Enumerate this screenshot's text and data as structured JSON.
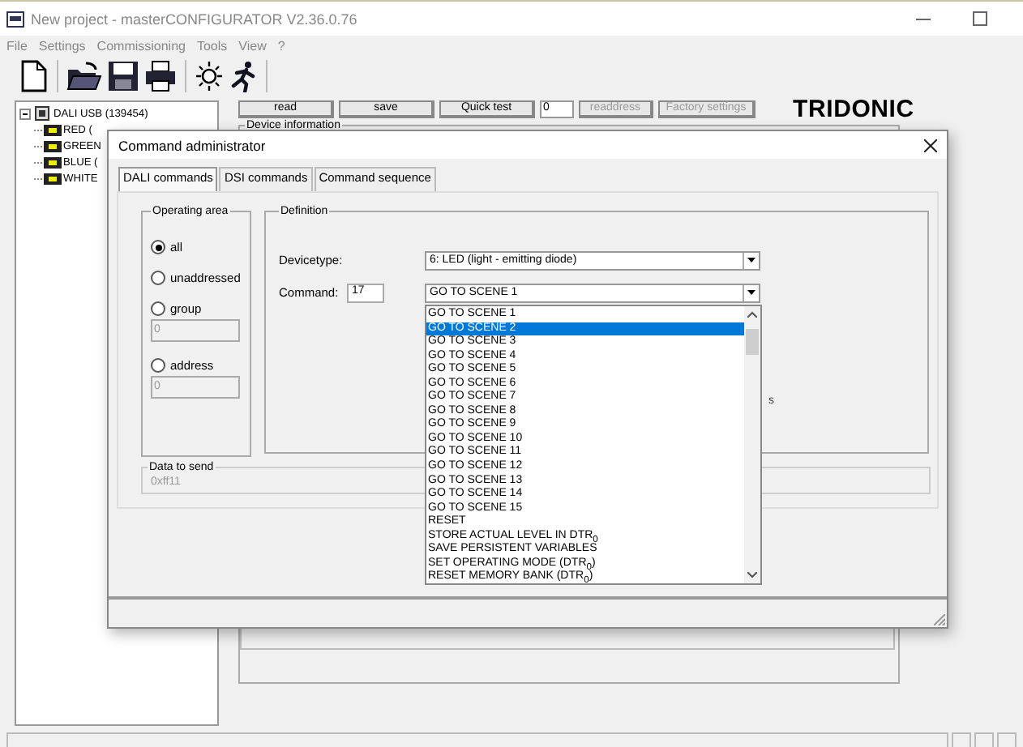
{
  "window": {
    "title": "New project - masterCONFIGURATOR V2.36.0.76"
  },
  "menu": [
    "File",
    "Settings",
    "Commissioning",
    "Tools",
    "View",
    "?"
  ],
  "tree": {
    "label": "DALI USB (139454)",
    "expanded": true,
    "children": [
      {
        "label": "RED ("
      },
      {
        "label": "GREEN"
      },
      {
        "label": "BLUE ("
      },
      {
        "label": "WHITE"
      }
    ]
  },
  "controls": [
    {
      "kind": "button",
      "label": "read",
      "disabled": false
    },
    {
      "kind": "button",
      "label": "save",
      "disabled": false
    },
    {
      "kind": "button",
      "label": "Quick test",
      "disabled": false
    },
    {
      "kind": "field",
      "value": "0"
    },
    {
      "kind": "button",
      "label": "readdress",
      "disabled": true
    },
    {
      "kind": "button",
      "label": "Factory settings",
      "disabled": true
    }
  ],
  "logo": "TRIDONIC",
  "device_info": {
    "title": "Device information"
  },
  "dialog": {
    "title": "Command administrator",
    "tabs": [
      {
        "label": "DALI commands",
        "selected": true
      },
      {
        "label": "DSI commands",
        "selected": false
      },
      {
        "label": "Command sequence",
        "selected": false
      }
    ],
    "operating_area": {
      "title": "Operating area",
      "options": [
        {
          "label": "all",
          "selected": true
        },
        {
          "label": "unaddressed",
          "selected": false
        },
        {
          "label": "group",
          "selected": false,
          "field": "0"
        },
        {
          "label": "address",
          "selected": false,
          "field": "0"
        }
      ]
    },
    "definition": {
      "title": "Definition",
      "devicetype_label": "Devicetype:",
      "devicetype": "6: LED (light - emitting diode)",
      "command_label": "Command:",
      "command_number": "17",
      "command": "GO TO SCENE 1",
      "fragment": "s"
    },
    "dropdown": {
      "items": [
        {
          "label": "GO TO SCENE 1",
          "selected": false
        },
        {
          "label": "GO TO SCENE 2",
          "selected": true
        },
        {
          "label": "GO TO SCENE 3",
          "selected": false
        },
        {
          "label": "GO TO SCENE 4",
          "selected": false
        },
        {
          "label": "GO TO SCENE 5",
          "selected": false
        },
        {
          "label": "GO TO SCENE 6",
          "selected": false
        },
        {
          "label": "GO TO SCENE 7",
          "selected": false
        },
        {
          "label": "GO TO SCENE 8",
          "selected": false
        },
        {
          "label": "GO TO SCENE 9",
          "selected": false
        },
        {
          "label": "GO TO SCENE 10",
          "selected": false
        },
        {
          "label": "GO TO SCENE 11",
          "selected": false
        },
        {
          "label": "GO TO SCENE 12",
          "selected": false
        },
        {
          "label": "GO TO SCENE 13",
          "selected": false
        },
        {
          "label": "GO TO SCENE 14",
          "selected": false
        },
        {
          "label": "GO TO SCENE 15",
          "selected": false
        },
        {
          "label": "RESET",
          "selected": false
        },
        {
          "label": "STORE ACTUAL LEVEL IN DTR$_{0}$",
          "selected": false
        },
        {
          "label": "SAVE PERSISTENT VARIABLES",
          "selected": false
        },
        {
          "label": "SET OPERATING MODE (DTR$_{0}$)",
          "selected": false
        },
        {
          "label": "RESET MEMORY BANK (DTR$_{0}$)",
          "selected": false
        }
      ]
    },
    "data_to_send": {
      "title": "Data to send",
      "value": "0xff11"
    }
  }
}
